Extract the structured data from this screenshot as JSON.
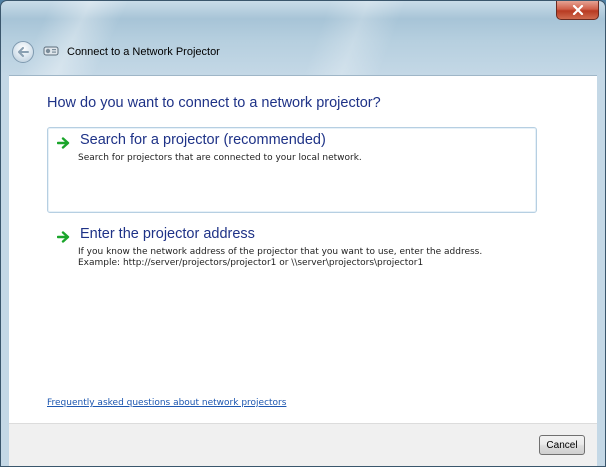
{
  "window": {
    "title": "Connect to a Network Projector",
    "close_glyph": "x",
    "accent_close": "#c8452c",
    "accent_text": "#1e3287"
  },
  "icons": {
    "back": "back-arrow-icon",
    "app": "network-projector-icon",
    "close": "close-icon",
    "option_arrow": "green-arrow-icon"
  },
  "main": {
    "question": "How do you want to connect to a network projector?",
    "options": [
      {
        "title": "Search for a projector (recommended)",
        "desc_line1": "Search for projectors that are connected to your local network.",
        "desc_line2": ""
      },
      {
        "title": "Enter the projector address",
        "desc_line1": "If you know the network address of the projector that you want to use, enter the address.",
        "desc_line2": "Example: http://server/projectors/projector1 or \\\\server\\projectors\\projector1"
      }
    ],
    "faq_link": "Frequently asked questions about network projectors"
  },
  "footer": {
    "cancel_label": "Cancel"
  }
}
